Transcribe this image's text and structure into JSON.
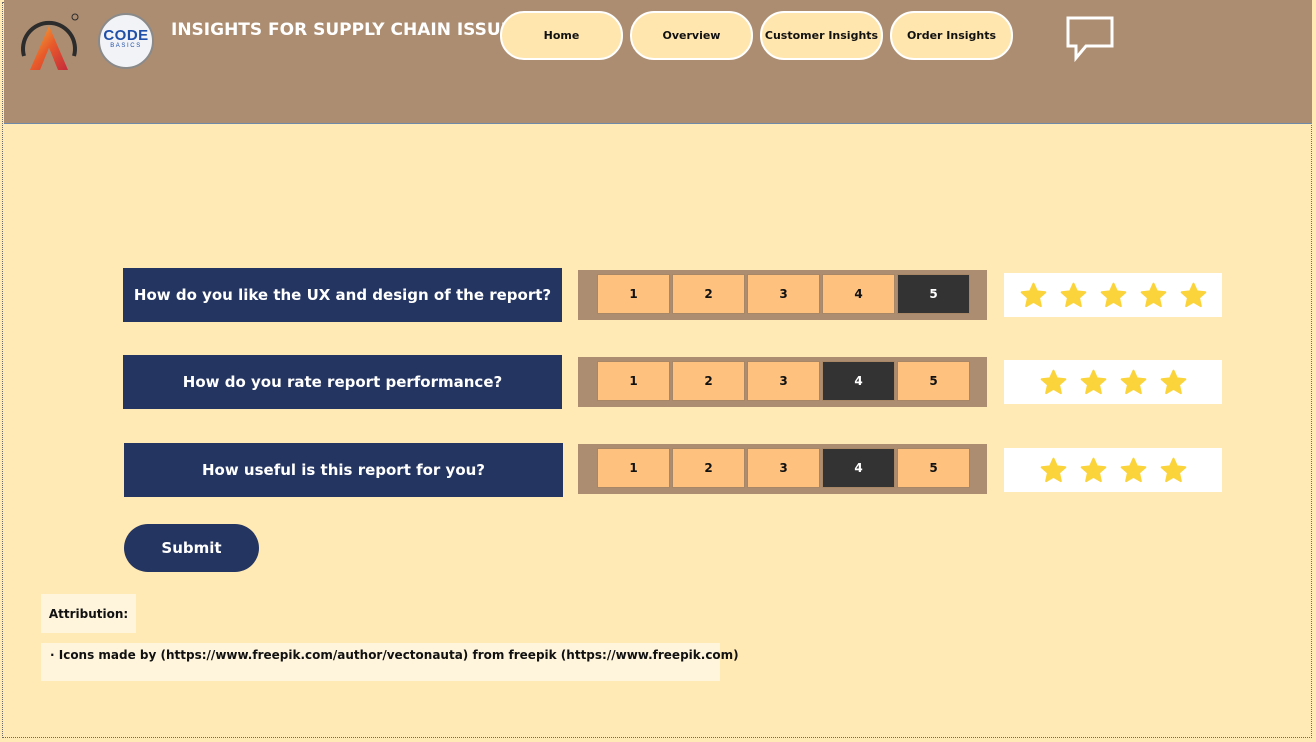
{
  "header": {
    "title": "INSIGHTS FOR SUPPLY CHAIN ISSUE",
    "logo_cb_main": "CODE",
    "logo_cb_sub": "BASICS",
    "nav": [
      "Home",
      "Overview",
      "Customer Insights",
      "Order Insights"
    ],
    "background_color": "#ac8d71"
  },
  "survey": {
    "questions": [
      {
        "text": "How do you like the UX and design of the report?",
        "options": [
          "1",
          "2",
          "3",
          "4",
          "5"
        ],
        "selected": 5,
        "stars": 5
      },
      {
        "text": "How do you rate report performance?",
        "options": [
          "1",
          "2",
          "3",
          "4",
          "5"
        ],
        "selected": 4,
        "stars": 4
      },
      {
        "text": "How useful is this report for you?",
        "options": [
          "1",
          "2",
          "3",
          "4",
          "5"
        ],
        "selected": 4,
        "stars": 4
      }
    ],
    "submit_label": "Submit"
  },
  "attribution": {
    "label": "Attribution:",
    "credit": "· Icons made by (https://www.freepik.com/author/vectonauta) from freepik (https://www.freepik.com)"
  },
  "colors": {
    "page_bg": "#ffeab5",
    "question_bg": "#253561",
    "option_bg": "#ffc27e",
    "option_selected": "#333333",
    "star": "#fbd33a"
  },
  "icons": [
    "logo-a-icon",
    "codebasics-logo",
    "chat-bubble-icon",
    "star-icon"
  ]
}
